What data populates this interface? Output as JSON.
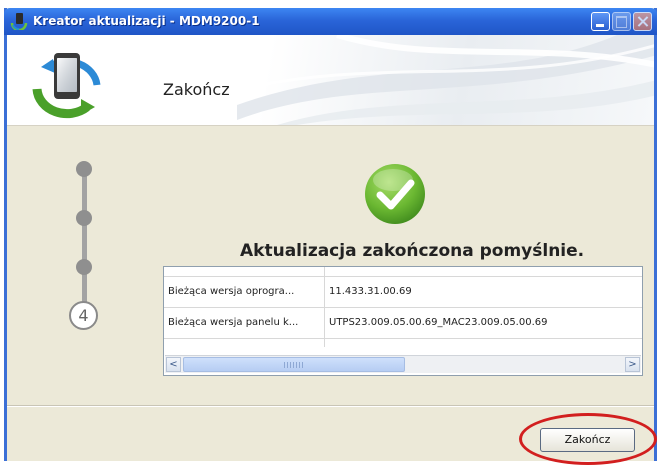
{
  "window": {
    "title": "Kreator aktualizacji - MDM9200-1"
  },
  "header": {
    "title": "Zakończ",
    "logo_icon": "phone-sync-icon"
  },
  "steps": {
    "current_step": "4",
    "completed_steps": 3
  },
  "result": {
    "icon": "checkmark-icon",
    "message": "Aktualizacja zakończona pomyślnie."
  },
  "table": {
    "rows": [
      {
        "label": "Bieżąca wersja oprogra...",
        "value": "11.433.31.00.69"
      },
      {
        "label": "Bieżąca wersja panelu k...",
        "value": "UTPS23.009.05.00.69_MAC23.009.05.00.69"
      }
    ]
  },
  "scrollbar": {
    "left_arrow": "<",
    "right_arrow": ">"
  },
  "footer": {
    "finish_label": "Zakończ"
  },
  "colors": {
    "titlebar": "#2a65d9",
    "success_green": "#6bb832",
    "highlight_ellipse": "#d21f1f"
  }
}
